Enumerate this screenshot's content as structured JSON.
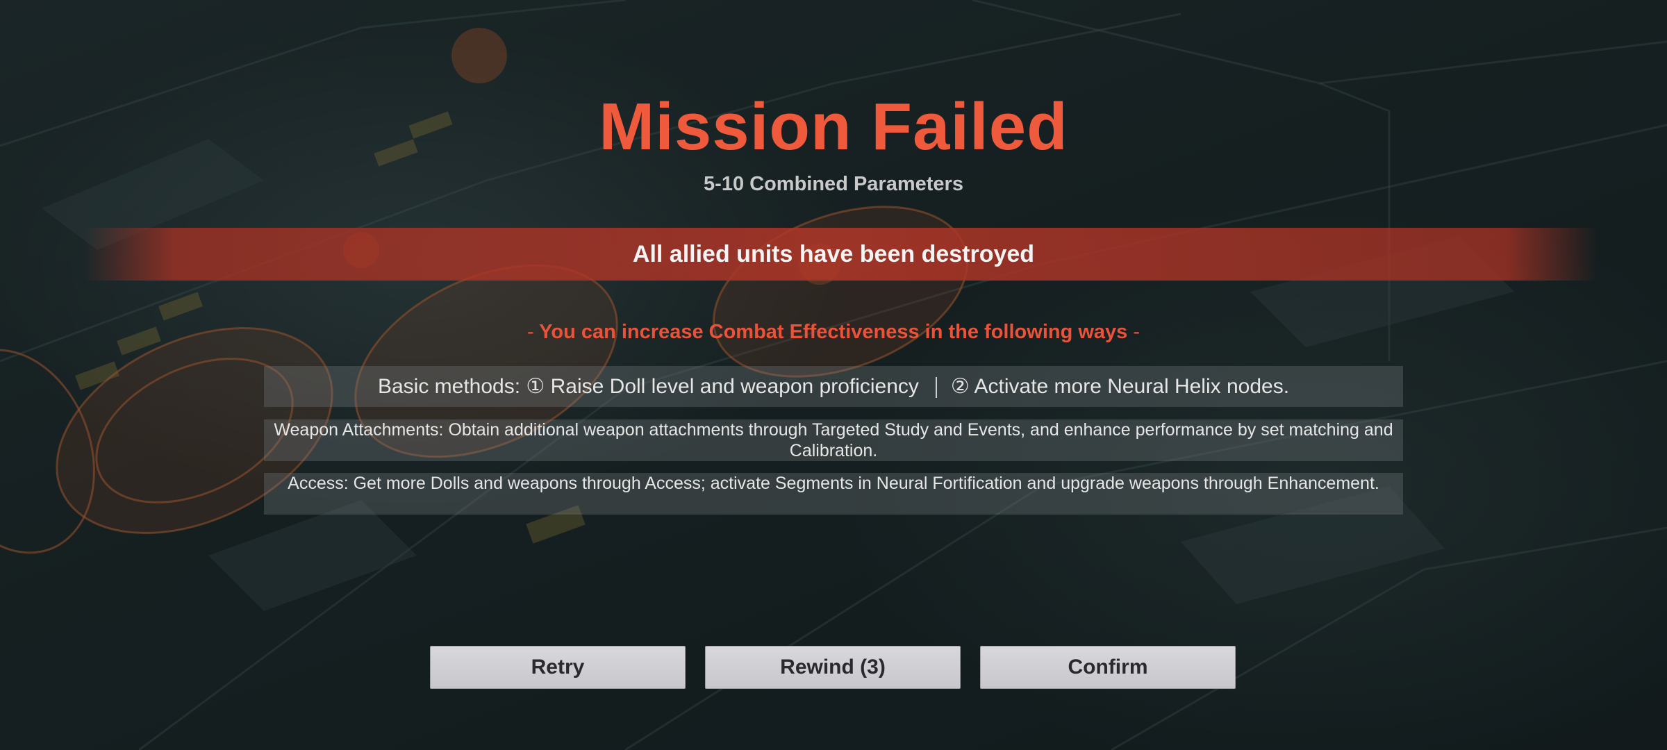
{
  "result": {
    "title": "Mission Failed",
    "stage": "5-10 Combined Parameters",
    "reason": "All allied units have been destroyed"
  },
  "tips": {
    "header_dash_left": "-",
    "header": "You can increase Combat Effectiveness in the following ways",
    "header_dash_right": "-",
    "basic_part1": "Basic methods: ① Raise Doll level and weapon proficiency",
    "basic_part2": "② Activate more Neural Helix nodes.",
    "attachments": "Weapon Attachments: Obtain additional weapon attachments through Targeted Study and Events, and enhance performance by set matching and Calibration.",
    "access": "Access: Get more Dolls and weapons through Access; activate Segments in Neural Fortification and upgrade weapons through Enhancement."
  },
  "buttons": {
    "retry": "Retry",
    "rewind": "Rewind (3)",
    "confirm": "Confirm"
  },
  "colors": {
    "title": "#f05a3c",
    "banner": "#b03628",
    "tips_header": "#e8533a",
    "button_bg": "#d0d0d4"
  }
}
